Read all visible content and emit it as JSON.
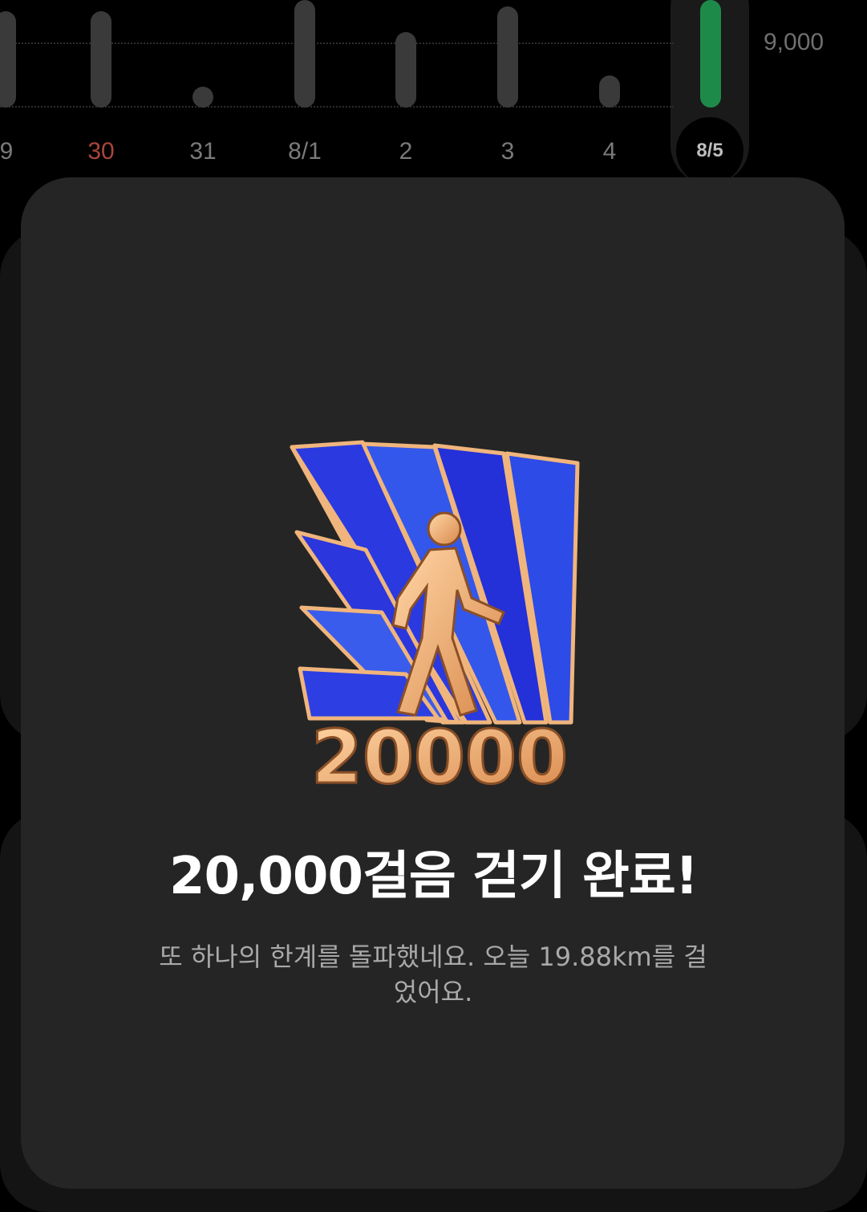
{
  "chart": {
    "goal_label": "9,000",
    "days": [
      {
        "label": "9",
        "sun": false,
        "steps": 9000
      },
      {
        "label": "30",
        "sun": true,
        "steps": 9000
      },
      {
        "label": "31",
        "sun": false,
        "steps": 800
      },
      {
        "label": "8/1",
        "sun": false,
        "steps": 11000
      },
      {
        "label": "2",
        "sun": false,
        "steps": 7400
      },
      {
        "label": "3",
        "sun": false,
        "steps": 10000
      },
      {
        "label": "4",
        "sun": false,
        "steps": 3000
      },
      {
        "label": "8/5",
        "sun": false,
        "steps": 20000,
        "today": true
      }
    ]
  },
  "achievement": {
    "badge_number": "20000",
    "title": "20,000걸음 걷기 완료!",
    "message": "또 하나의 한계를 돌파했네요. 오늘 19.88km를 걸었어요."
  },
  "colors": {
    "background": "#000000",
    "sheet": "#252525",
    "today_bar": "#1e8a4a",
    "sunday_label": "#a8453c",
    "badge_blue": "#2f3cf0",
    "badge_gold": "#f3b57a"
  }
}
